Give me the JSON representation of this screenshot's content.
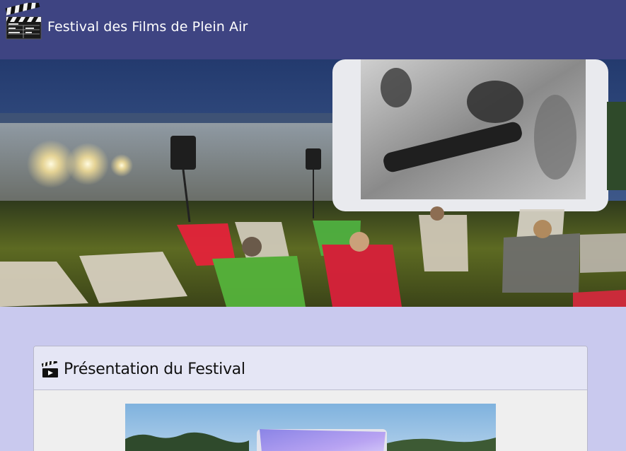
{
  "header": {
    "title": "Festival des Films de Plein Air",
    "logo_icon": "clapperboard-icon"
  },
  "hero": {
    "image": "outdoor-cinema-photo"
  },
  "section": {
    "icon": "clapperboard-icon",
    "title": "Présentation du Festival",
    "image": "inflatable-screen-photo"
  },
  "colors": {
    "header_bg": "#3e4482",
    "page_bg": "#c9c9ee",
    "card_header_bg": "#e5e6f5",
    "card_body_bg": "#efefef"
  }
}
